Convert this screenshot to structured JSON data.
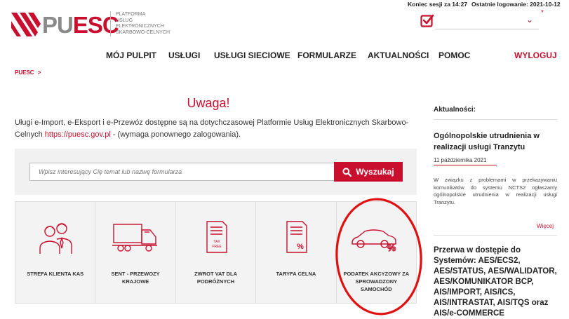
{
  "header": {
    "logo_pu": "PU",
    "logo_esc": "ESC",
    "logo_sub": [
      "PLATFORMA",
      "USŁUG",
      "ELEKTRONICZNYCH",
      "SKARBOWO-CELNYCH"
    ],
    "session_end": "Koniec sesji za 14:27",
    "last_login": "Ostatnie logowanie: 2021-10-12",
    "role_select_value": "",
    "required_marker": "*"
  },
  "nav": {
    "items": [
      "MÓJ PULPIT",
      "USŁUGI",
      "USŁUGI SIECIOWE",
      "FORMULARZE",
      "AKTUALNOŚCI",
      "POMOC"
    ],
    "logout": "WYLOGUJ"
  },
  "breadcrumb": {
    "label": "PUESC",
    "separator": ">"
  },
  "main": {
    "title": "Uwaga!",
    "info_before": "Uługi e-Import, e-Eksport i e-Przewóz dostępne są na dotychczasowej Platformie Usług Elektronicznych Skarbowo-Celnych ",
    "info_link": "https://puesc.gov.pl",
    "info_after": " - (wymaga ponownego zalogowania).",
    "search_placeholder": "Wpisz interesujący Cię temat lub nazwę formularza",
    "search_button": "Wyszukaj"
  },
  "tiles": [
    {
      "label": "STREFA KLIENTA KAS",
      "icon": "people-icon"
    },
    {
      "label": "SENT - PRZEWOZY KRAJOWE",
      "icon": "truck-icon"
    },
    {
      "label": "ZWROT VAT DLA PODRÓŻNYCH",
      "icon": "tax-free-icon"
    },
    {
      "label": "TARYFA CELNA",
      "icon": "tariff-document-icon"
    },
    {
      "label": "PODATEK AKCYZOWY ZA SPROWADZONY SAMOCHÓD",
      "icon": "car-percent-icon"
    }
  ],
  "sidebar": {
    "heading": "Aktualności:",
    "article1": {
      "title": "Ogólnopolskie utrudnienia w realizacji usługi Tranzytu",
      "date": "11 października 2021",
      "text": "W związku z problemami w przekazywaniu komunikatów do systemu NCTS2 ogłaszamy ogólnopolskie utrudnienia w realizacji usługi Tranzytu.",
      "more": "Więcej"
    },
    "article2": {
      "title": "Przerwa w dostępie do Systemów: AES/ECS2, AES/STATUS, AES/WALIDATOR, AES/KOMUNIKATOR BCP, AIS/IMPORT, AIS/ICS, AIS/INTRASTAT, AIS/TQS oraz AIS/e-COMMERCE"
    }
  },
  "colors": {
    "accent": "#c8102e",
    "annotation": "#e01010"
  }
}
